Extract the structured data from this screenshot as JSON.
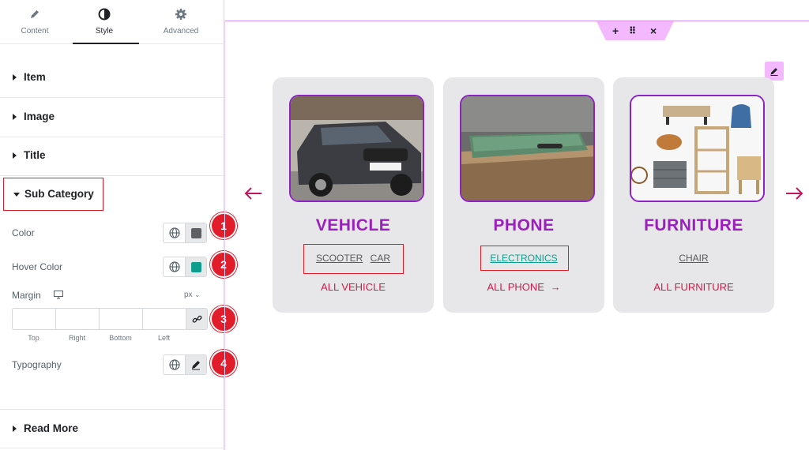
{
  "panel": {
    "tabs": [
      {
        "label": "Content",
        "icon": "pencil-icon"
      },
      {
        "label": "Style",
        "icon": "half-circle-icon",
        "active": true
      },
      {
        "label": "Advanced",
        "icon": "gear-icon"
      }
    ],
    "sections": {
      "item": "Item",
      "image": "Image",
      "title": "Title",
      "sub_category": "Sub Category",
      "read_more": "Read More"
    },
    "controls": {
      "color_label": "Color",
      "color_value": "#5f6063",
      "hover_color_label": "Hover Color",
      "hover_color_value": "#0e9e8e",
      "margin_label": "Margin",
      "unit": "px",
      "margin_fields": [
        "Top",
        "Right",
        "Bottom",
        "Left"
      ],
      "typography_label": "Typography"
    },
    "badges": [
      "1",
      "2",
      "3",
      "4"
    ]
  },
  "canvas": {
    "handle": {
      "add": "+",
      "drag": "⠿",
      "close": "×"
    },
    "cards": [
      {
        "title": "VEHICLE",
        "subcategories": [
          "SCOOTER",
          "CAR"
        ],
        "more": "ALL VEHICLE",
        "image": "car-photo"
      },
      {
        "title": "PHONE",
        "subcategories": [
          "ELECTRONICS"
        ],
        "more": "ALL PHONE",
        "more_arrow": "→",
        "image": "phone-photo"
      },
      {
        "title": "FURNITURE",
        "subcategories": [
          "CHAIR"
        ],
        "more": "ALL FURNITURE",
        "image": "furniture-photo"
      }
    ],
    "colors": {
      "accent_purple": "#9b1fbd",
      "more_red": "#d21a4a",
      "hover_teal": "#0e9e8e",
      "highlight_red": "#e11d2b"
    }
  }
}
